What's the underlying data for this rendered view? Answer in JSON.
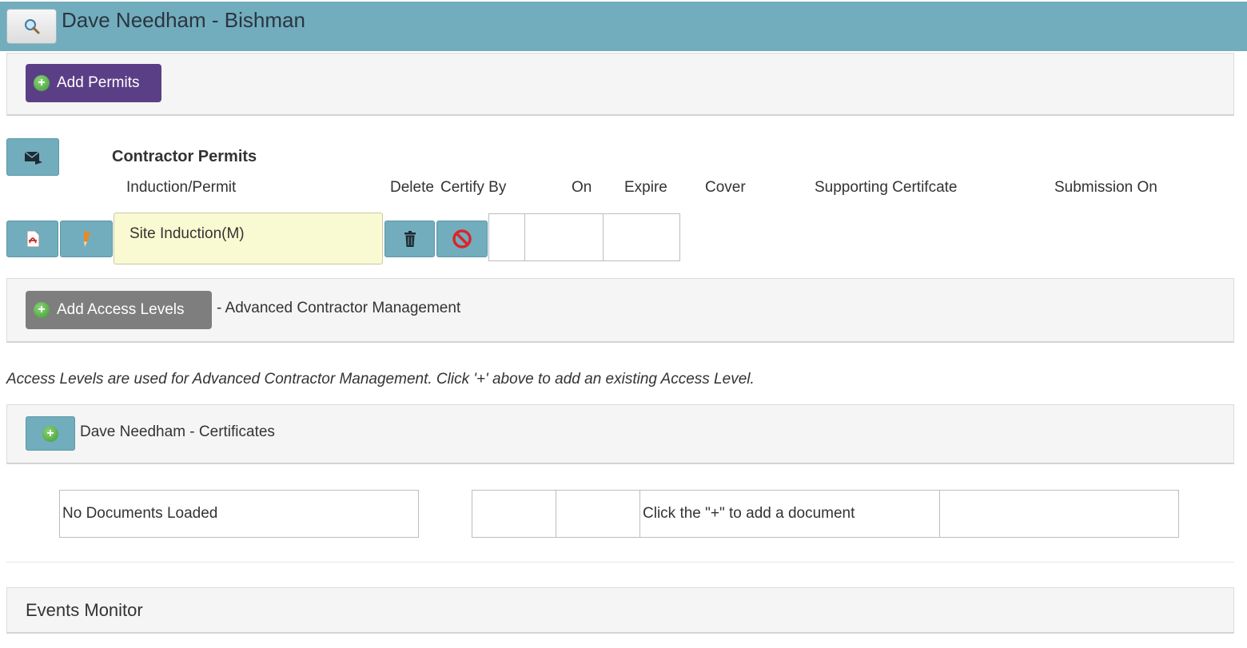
{
  "header": {
    "title": "Dave Needham - Bishman",
    "search_icon": "search-icon"
  },
  "permits_panel": {
    "add_label": "Add Permits"
  },
  "contractor_permits": {
    "mail_icon": "envelope-icon",
    "heading": "Contractor Permits",
    "columns": [
      "Induction/Permit",
      "Delete",
      "Certify By",
      "On",
      "Expire",
      "Cover",
      "Supporting Certifcate",
      "Submission On"
    ],
    "rows": [
      {
        "name": "Site Induction(M)"
      }
    ]
  },
  "access_panel": {
    "add_label": "Add Access Levels",
    "suffix": "- Advanced Contractor Management"
  },
  "access_note": "Access Levels are used for Advanced Contractor Management. Click '+' above to add an existing Access Level.",
  "certificates_panel": {
    "title": "Dave Needham - Certificates"
  },
  "documents": {
    "empty_text": "No Documents Loaded",
    "hint_text": "Click the \"+\" to add a document"
  },
  "events_panel": {
    "title": "Events Monitor"
  },
  "colors": {
    "header": "#72adbd",
    "primary_button": "#5b3f86",
    "secondary_button": "#7e7e7e",
    "highlight_cell": "#fafad2"
  }
}
